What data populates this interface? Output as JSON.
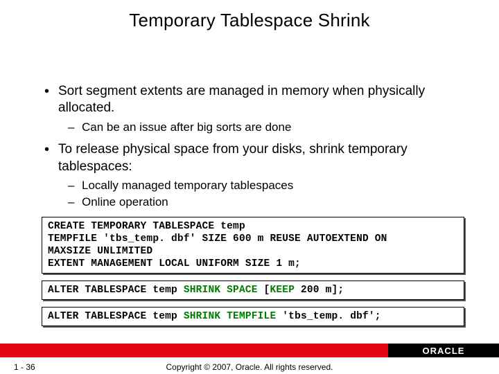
{
  "title": "Temporary Tablespace Shrink",
  "bullets": [
    {
      "text": "Sort segment extents are managed in memory when physically allocated.",
      "sub": [
        "Can be an issue after big sorts are done"
      ]
    },
    {
      "text": "To release physical space from your disks, shrink temporary tablespaces:",
      "sub": [
        "Locally managed temporary tablespaces",
        "Online operation"
      ]
    }
  ],
  "code": {
    "block1_l1": "CREATE TEMPORARY TABLESPACE temp",
    "block1_l2": "TEMPFILE 'tbs_temp. dbf' SIZE 600 m REUSE AUTOEXTEND ON",
    "block1_l3": "MAXSIZE UNLIMITED",
    "block1_l4": "EXTENT MANAGEMENT LOCAL UNIFORM SIZE 1 m;",
    "block2_pre": "ALTER TABLESPACE temp ",
    "block2_shrink": "SHRINK SPACE",
    "block2_mid": " [",
    "block2_keep": "KEEP",
    "block2_post": " 200 m];",
    "block3_pre": "ALTER TABLESPACE temp ",
    "block3_shrink": "SHRINK TEMPFILE",
    "block3_post": " 'tbs_temp. dbf';"
  },
  "footer": {
    "page": "1 - 36",
    "copyright": "Copyright © 2007, Oracle. All rights reserved.",
    "logo": "ORACLE"
  }
}
